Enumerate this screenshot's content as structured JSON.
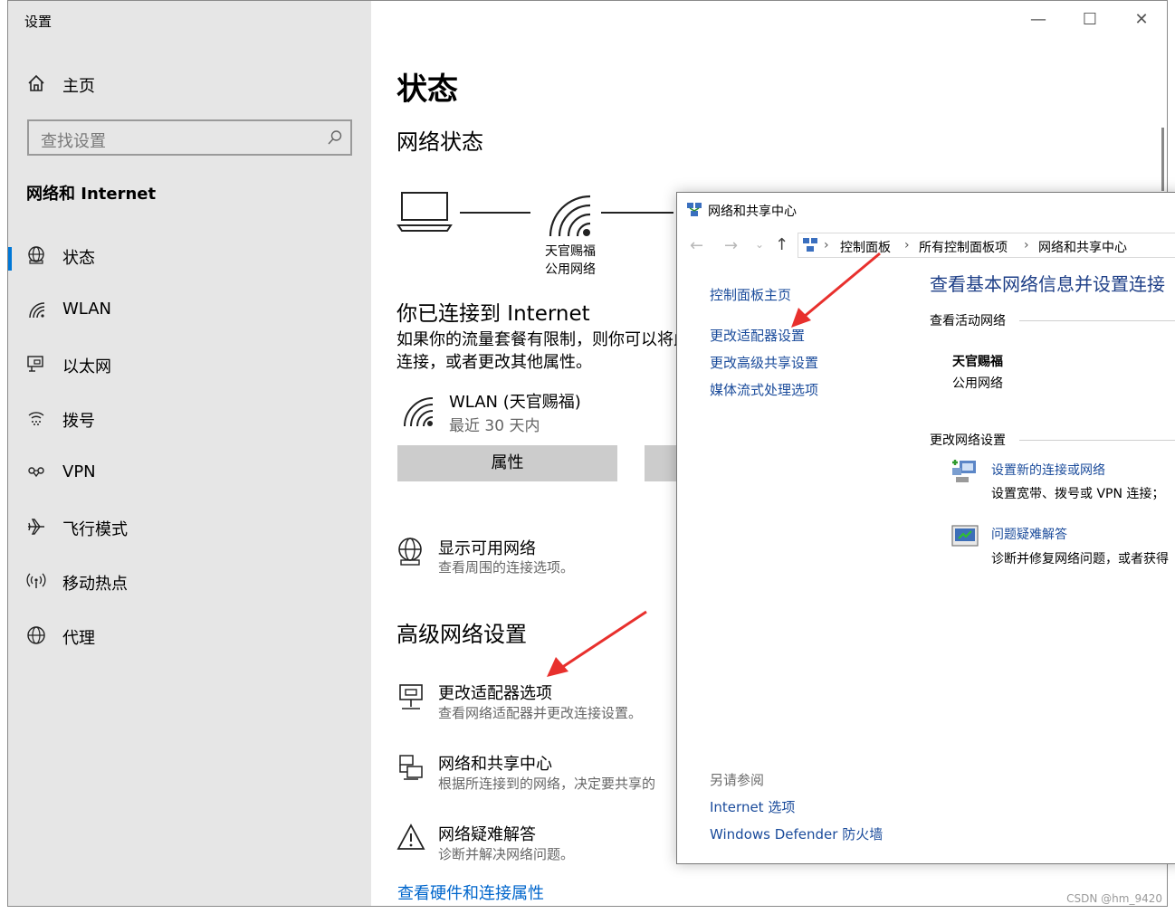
{
  "settings": {
    "window_title": "设置",
    "home_label": "主页",
    "search_placeholder": "查找设置",
    "section_title": "网络和 Internet",
    "nav": [
      {
        "label": "状态",
        "icon": "globe-status-icon"
      },
      {
        "label": "WLAN",
        "icon": "wifi-icon"
      },
      {
        "label": "以太网",
        "icon": "ethernet-icon"
      },
      {
        "label": "拨号",
        "icon": "dialup-icon"
      },
      {
        "label": "VPN",
        "icon": "vpn-icon"
      },
      {
        "label": "飞行模式",
        "icon": "airplane-icon"
      },
      {
        "label": "移动热点",
        "icon": "hotspot-icon"
      },
      {
        "label": "代理",
        "icon": "proxy-globe-icon"
      }
    ],
    "selected_nav": "状态",
    "page_title": "状态",
    "network_status_title": "网络状态",
    "network_name": "天官赐福",
    "network_type": "公用网络",
    "connected_title": "你已连接到 Internet",
    "connected_desc_line1": "如果你的流量套餐有限制，则你可以将此",
    "connected_desc_line2": "连接，或者更改其他属性。",
    "wlan_title": "WLAN (天官赐福)",
    "wlan_sub": "最近 30 天内",
    "properties_button": "属性",
    "show_networks_title": "显示可用网络",
    "show_networks_sub": "查看周围的连接选项。",
    "advanced_title": "高级网络设置",
    "adv_items": [
      {
        "title": "更改适配器选项",
        "sub": "查看网络适配器并更改连接设置。"
      },
      {
        "title": "网络和共享中心",
        "sub": "根据所连接到的网络，决定要共享的"
      },
      {
        "title": "网络疑难解答",
        "sub": "诊断并解决网络问题。"
      }
    ],
    "hardware_link": "查看硬件和连接属性"
  },
  "control_panel": {
    "window_title": "网络和共享中心",
    "breadcrumb": [
      "控制面板",
      "所有控制面板项",
      "网络和共享中心"
    ],
    "left_links": [
      "控制面板主页",
      "更改适配器设置",
      "更改高级共享设置",
      "媒体流式处理选项"
    ],
    "heading": "查看基本网络信息并设置连接",
    "active_networks_label": "查看活动网络",
    "network_name": "天官赐福",
    "network_type": "公用网络",
    "change_settings_label": "更改网络设置",
    "tasks": [
      {
        "title": "设置新的连接或网络",
        "sub": "设置宽带、拨号或 VPN 连接；"
      },
      {
        "title": "问题疑难解答",
        "sub": "诊断并修复网络问题，或者获得"
      }
    ],
    "see_also_label": "另请参阅",
    "see_also_links": [
      "Internet 选项",
      "Windows Defender 防火墙"
    ]
  },
  "watermark": "CSDN @hm_9420",
  "colors": {
    "accent": "#0078d7",
    "arrow": "#e8302d",
    "link": "#0066cc",
    "sidebar_bg": "#e6e6e6"
  }
}
